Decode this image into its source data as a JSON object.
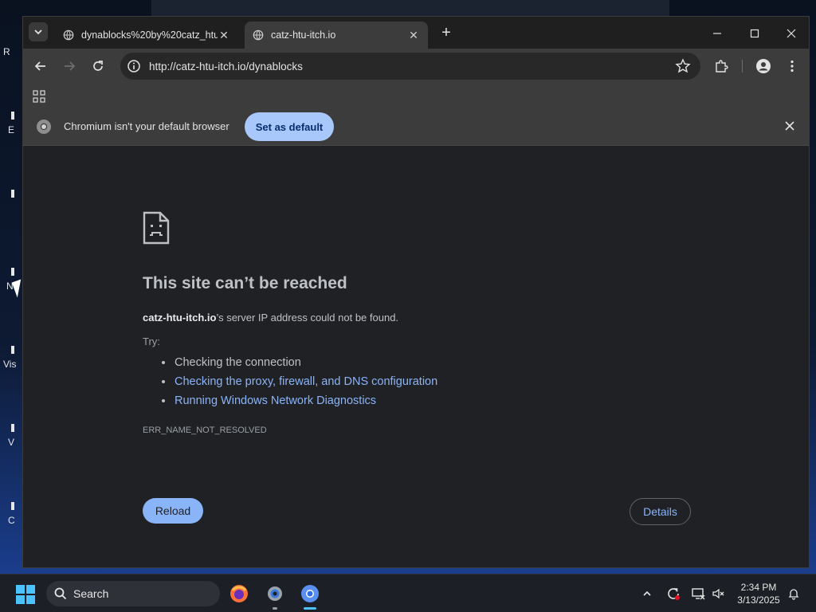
{
  "desktop": {
    "icon_labels": [
      "R",
      "E",
      "N",
      "Vis",
      "V",
      "C"
    ]
  },
  "browser": {
    "tabs": [
      {
        "title": "dynablocks%20by%20catz_htu",
        "active": false
      },
      {
        "title": "catz-htu-itch.io",
        "active": true
      }
    ],
    "new_tab_symbol": "+",
    "url": "http://catz-htu-itch.io/dynablocks",
    "icons": {
      "tab_search": "chevron-down-icon",
      "back": "back-arrow-icon",
      "forward": "forward-arrow-icon",
      "reload": "reload-icon",
      "info": "info-icon",
      "star": "star-icon",
      "extensions": "puzzle-icon",
      "profile": "person-icon",
      "menu": "kebab-menu-icon"
    }
  },
  "infobar": {
    "message": "Chromium isn't your default browser",
    "button_label": "Set as default"
  },
  "error_page": {
    "headline": "This site can’t be reached",
    "host": "catz-htu-itch.io",
    "reason_suffix": "’s server IP address could not be found.",
    "try_label": "Try:",
    "suggestions": [
      "Checking the connection",
      "Checking the proxy, firewall, and DNS configuration",
      "Running Windows Network Diagnostics"
    ],
    "error_code": "ERR_NAME_NOT_RESOLVED",
    "reload_label": "Reload",
    "details_label": "Details"
  },
  "taskbar": {
    "search_label": "Search",
    "time": "2:34 PM",
    "date": "3/13/2025",
    "apps": [
      "firefox-icon",
      "settings-gear-icon",
      "chromium-icon"
    ]
  },
  "colors": {
    "accent_blue": "#8ab4f8",
    "infobar_button": "#a8c7fa",
    "page_bg": "#202124"
  }
}
